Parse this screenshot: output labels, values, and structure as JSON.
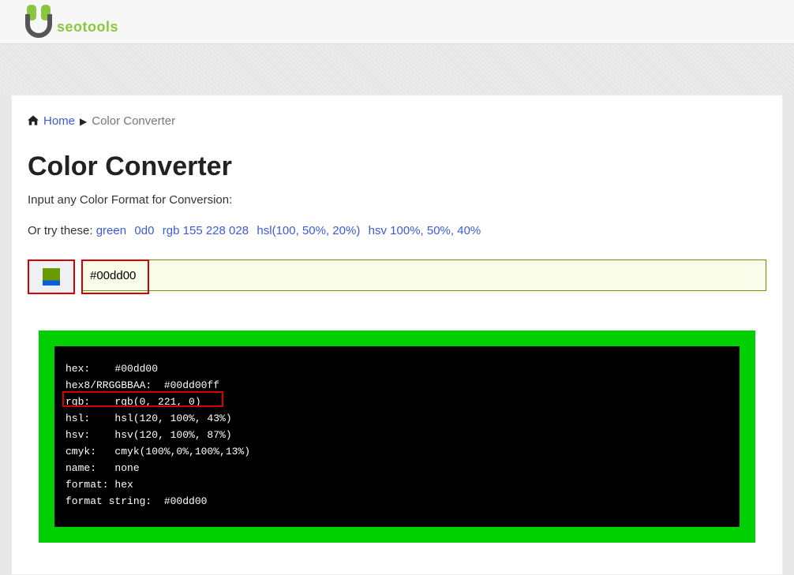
{
  "logo_text": "seotools",
  "breadcrumb": {
    "home_label": "Home",
    "current": "Color Converter"
  },
  "title": "Color Converter",
  "subtitle": "Input any Color Format for Conversion:",
  "examples_prefix": "Or try these: ",
  "examples": {
    "e1": "green",
    "e2": "0d0",
    "e3": "rgb 155 228 028",
    "e4": "hsl(100, 50%, 20%)",
    "e5": "hsv 100%, 50%, 40%"
  },
  "input_value": "#00dd00",
  "terminal_lines": {
    "l1": "hex:    #00dd00",
    "l2": "hex8/RRGGBBAA:  #00dd00ff",
    "l3": "rgb:    rgb(0, 221, 0)",
    "l4": "hsl:    hsl(120, 100%, 43%)",
    "l5": "hsv:    hsv(120, 100%, 87%)",
    "l6": "cmyk:   cmyk(100%,0%,100%,13%)",
    "l7": "name:   none",
    "l8": "format: hex",
    "l9": "format string:  #00dd00"
  }
}
